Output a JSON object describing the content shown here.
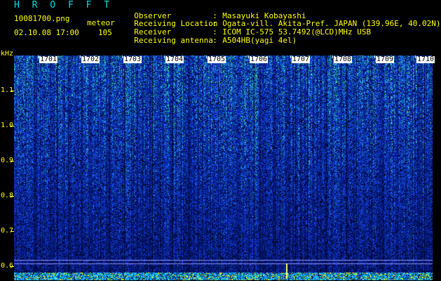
{
  "header": {
    "title": "H R O F F T",
    "filename": "10081700.png",
    "datetime": "02.10.08 17:00",
    "meteor_label": "meteor",
    "meteor_count": "105"
  },
  "info": [
    {
      "key": "Observer",
      "value": "Masayuki Kobayashi"
    },
    {
      "key": "Receiving Location",
      "value": "Ogata-vill. Akita-Pref. JAPAN (139.96E, 40.02N)"
    },
    {
      "key": "Receiver",
      "value": "ICOM IC-575 53.7492(@LCD)MHz USB"
    },
    {
      "key": "Receiving antenna",
      "value": "A504HB(yagi 4el)"
    }
  ],
  "y_axis": {
    "unit": "kHz",
    "ticks": [
      "1.1",
      "1.0",
      "0.9",
      "0.8",
      "0.7",
      "0.6"
    ]
  },
  "x_axis": {
    "ticks": [
      "1701",
      "1702",
      "1703",
      "1704",
      "1705",
      "1706",
      "1707",
      "1708",
      "1709",
      "1710"
    ]
  },
  "colors": {
    "background": "#000000",
    "text": "#ffff00",
    "title": "#00e0e0",
    "spectrogram_base": "#0a1a8a",
    "signal_low": "#2050ff",
    "signal_high": "#30e0a0",
    "bottom_strip": "#00c0ff"
  }
}
